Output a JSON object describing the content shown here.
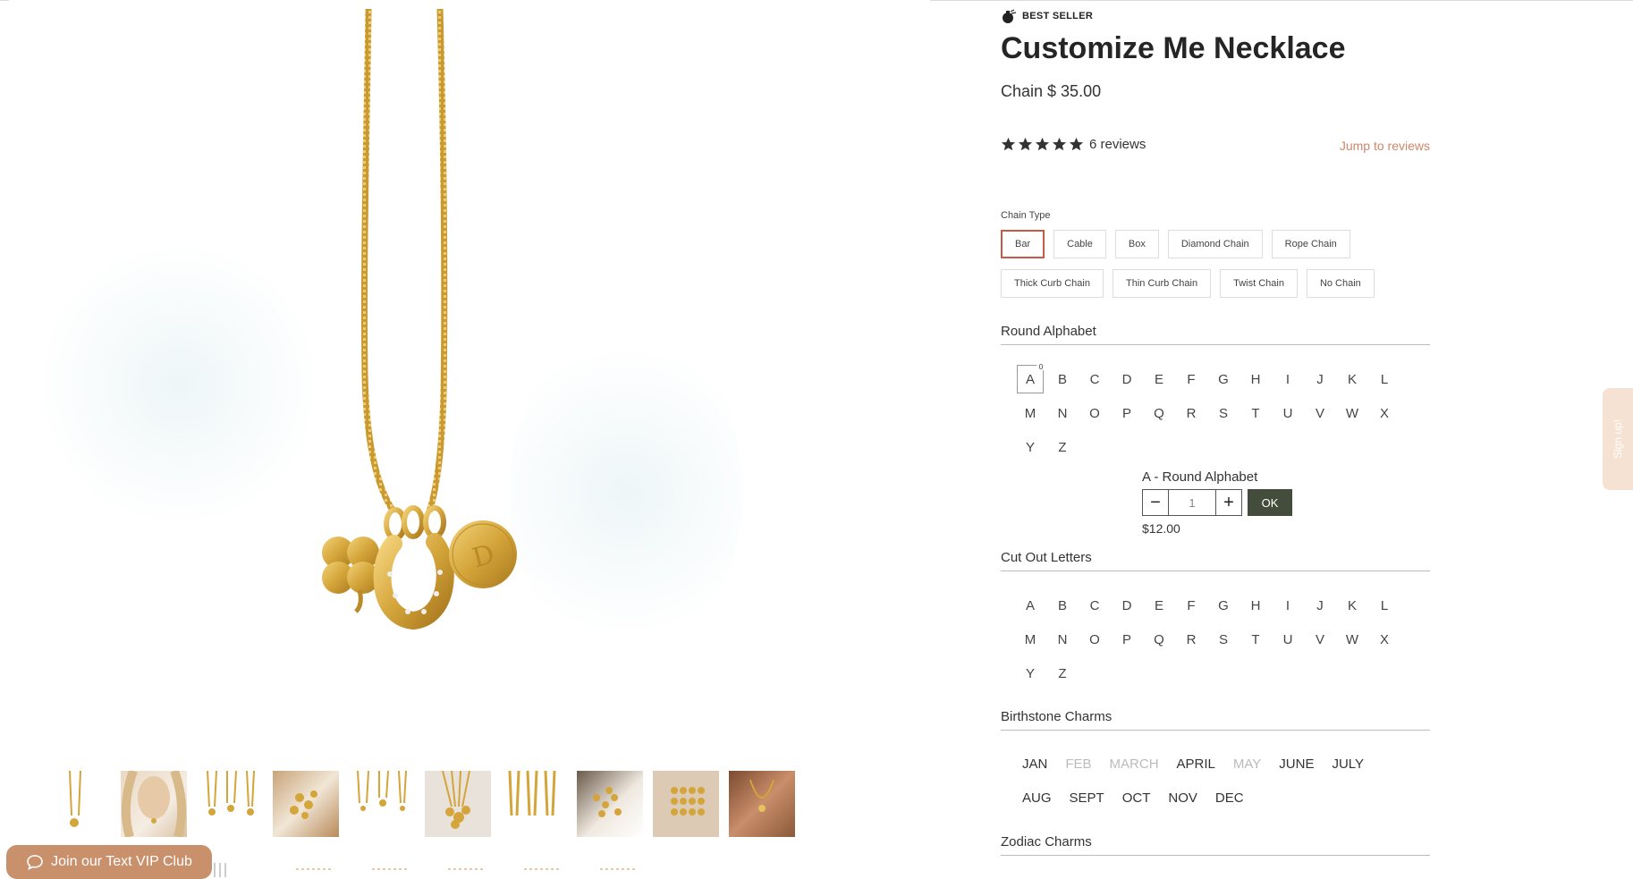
{
  "product": {
    "badge": "BEST SELLER",
    "title": "Customize Me Necklace",
    "price": "Chain $ 35.00",
    "rating": 5,
    "reviews_label": "6 reviews",
    "jump_label": "Jump to reviews"
  },
  "chain_type": {
    "label": "Chain Type",
    "row1": [
      "Bar",
      "Cable",
      "Box",
      "Diamond Chain",
      "Rope Chain"
    ],
    "row2": [
      "Thick Curb Chain",
      "Thin Curb Chain",
      "Twist Chain",
      "No Chain"
    ],
    "selected": "Bar"
  },
  "round_alphabet": {
    "label": "Round Alphabet",
    "letters": [
      "A",
      "B",
      "C",
      "D",
      "E",
      "F",
      "G",
      "H",
      "I",
      "J",
      "K",
      "L",
      "M",
      "N",
      "O",
      "P",
      "Q",
      "R",
      "S",
      "T",
      "U",
      "V",
      "W",
      "X",
      "Y",
      "Z"
    ],
    "selected": "A",
    "selected_count": "0"
  },
  "cart_popup": {
    "title": "A - Round Alphabet",
    "minus": "−",
    "plus": "+",
    "qty": "1",
    "ok_label": "OK",
    "price": "$12.00"
  },
  "cut_out_letters": {
    "label": "Cut Out Letters",
    "letters": [
      "A",
      "B",
      "C",
      "D",
      "E",
      "F",
      "G",
      "H",
      "I",
      "J",
      "K",
      "L",
      "M",
      "N",
      "O",
      "P",
      "Q",
      "R",
      "S",
      "T",
      "U",
      "V",
      "W",
      "X",
      "Y",
      "Z"
    ]
  },
  "birthstone": {
    "label": "Birthstone Charms",
    "months": [
      {
        "label": "JAN",
        "available": true
      },
      {
        "label": "FEB",
        "available": false
      },
      {
        "label": "MARCH",
        "available": false
      },
      {
        "label": "APRIL",
        "available": true
      },
      {
        "label": "MAY",
        "available": false
      },
      {
        "label": "JUNE",
        "available": true
      },
      {
        "label": "JULY",
        "available": true
      },
      {
        "label": "AUG",
        "available": true
      },
      {
        "label": "SEPT",
        "available": true
      },
      {
        "label": "OCT",
        "available": true
      },
      {
        "label": "NOV",
        "available": true
      },
      {
        "label": "DEC",
        "available": true
      }
    ]
  },
  "zodiac": {
    "label": "Zodiac Charms"
  },
  "vip": {
    "label": "Join our Text VIP Club"
  },
  "signup_tab": {
    "label": "Sign up!"
  },
  "colors": {
    "accent": "#c65b45",
    "link": "#d0866a",
    "ok_button": "#444c3c",
    "vip_button": "#c9906c",
    "gold": "#d4a53a"
  }
}
